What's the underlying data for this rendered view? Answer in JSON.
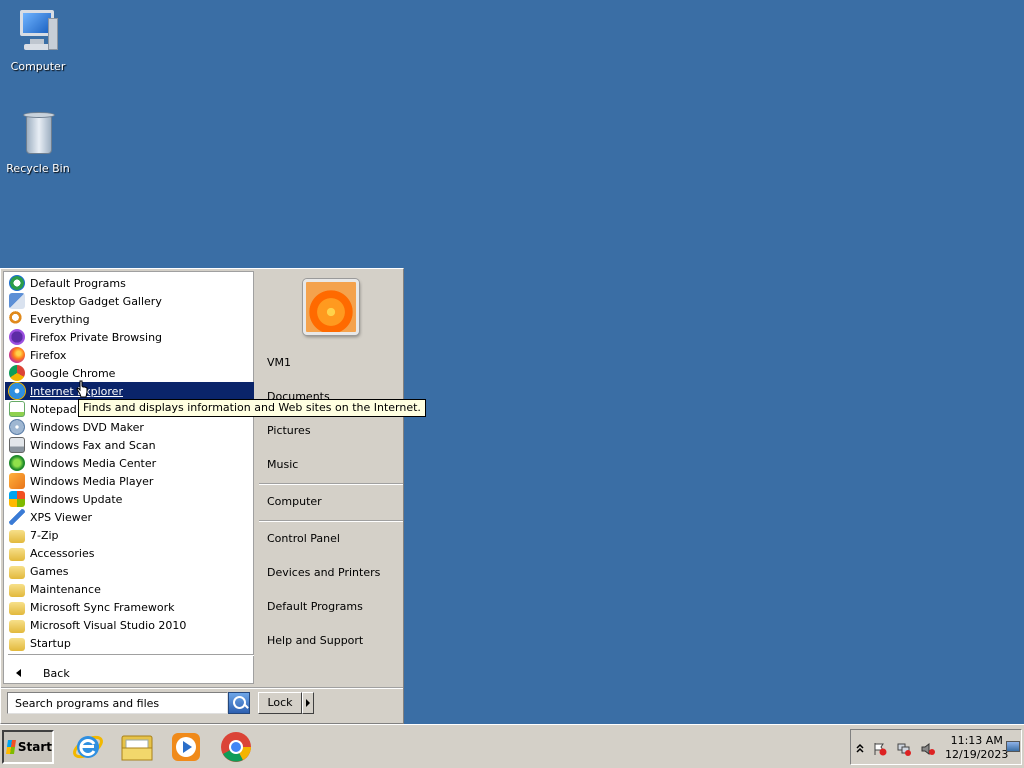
{
  "desktop": {
    "background": "#3a6ea5",
    "icons": [
      {
        "label": "Computer",
        "icon": "computer-icon"
      },
      {
        "label": "Recycle Bin",
        "icon": "recycle-bin-icon"
      }
    ]
  },
  "start_menu": {
    "programs": [
      {
        "label": "Default Programs",
        "icon": "default-programs-icon"
      },
      {
        "label": "Desktop Gadget Gallery",
        "icon": "gadget-gallery-icon"
      },
      {
        "label": "Everything",
        "icon": "everything-search-icon"
      },
      {
        "label": "Firefox Private Browsing",
        "icon": "firefox-private-icon"
      },
      {
        "label": "Firefox",
        "icon": "firefox-icon"
      },
      {
        "label": "Google Chrome",
        "icon": "chrome-icon"
      },
      {
        "label": "Internet Explorer",
        "icon": "internet-explorer-icon",
        "selected": true
      },
      {
        "label": "Notepad++",
        "icon": "notepad-plus-plus-icon"
      },
      {
        "label": "Windows DVD Maker",
        "icon": "dvd-maker-icon"
      },
      {
        "label": "Windows Fax and Scan",
        "icon": "fax-scan-icon"
      },
      {
        "label": "Windows Media Center",
        "icon": "media-center-icon"
      },
      {
        "label": "Windows Media Player",
        "icon": "media-player-icon"
      },
      {
        "label": "Windows Update",
        "icon": "windows-update-icon"
      },
      {
        "label": "XPS Viewer",
        "icon": "xps-viewer-icon"
      },
      {
        "label": "7-Zip",
        "icon": "folder-icon"
      },
      {
        "label": "Accessories",
        "icon": "folder-icon"
      },
      {
        "label": "Games",
        "icon": "folder-icon"
      },
      {
        "label": "Maintenance",
        "icon": "folder-icon"
      },
      {
        "label": "Microsoft Sync Framework",
        "icon": "folder-icon"
      },
      {
        "label": "Microsoft Visual Studio 2010",
        "icon": "folder-icon"
      },
      {
        "label": "Startup",
        "icon": "folder-icon"
      }
    ],
    "back_label": "Back",
    "search_placeholder": "Search programs and files",
    "lock_label": "Lock",
    "tooltip": "Finds and displays information and Web sites on the Internet.",
    "right_links": {
      "user": "VM1",
      "documents": "Documents",
      "pictures": "Pictures",
      "music": "Music",
      "computer": "Computer",
      "control_panel": "Control Panel",
      "devices": "Devices and Printers",
      "default_programs": "Default Programs",
      "help": "Help and Support"
    },
    "selection_color": "#0a246a"
  },
  "taskbar": {
    "start_label": "Start",
    "pinned": [
      {
        "name": "internet-explorer-taskbar-icon"
      },
      {
        "name": "windows-explorer-taskbar-icon"
      },
      {
        "name": "media-player-taskbar-icon"
      },
      {
        "name": "chrome-taskbar-icon"
      }
    ],
    "clock": {
      "time": "11:13 AM",
      "date": "12/19/2023"
    }
  }
}
